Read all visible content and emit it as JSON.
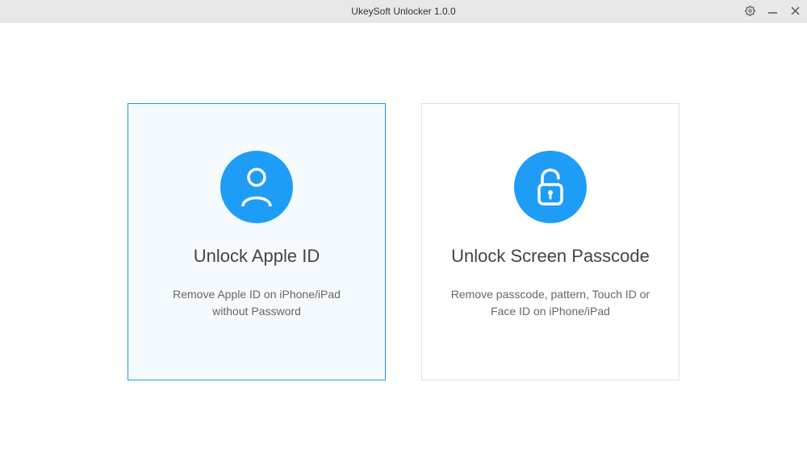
{
  "window": {
    "title": "UkeySoft Unlocker 1.0.0"
  },
  "cards": {
    "appleId": {
      "title": "Unlock Apple ID",
      "desc": "Remove Apple ID on iPhone/iPad without Password"
    },
    "screenPasscode": {
      "title": "Unlock Screen Passcode",
      "desc": "Remove passcode, pattern, Touch ID or Face ID on iPhone/iPad"
    }
  }
}
